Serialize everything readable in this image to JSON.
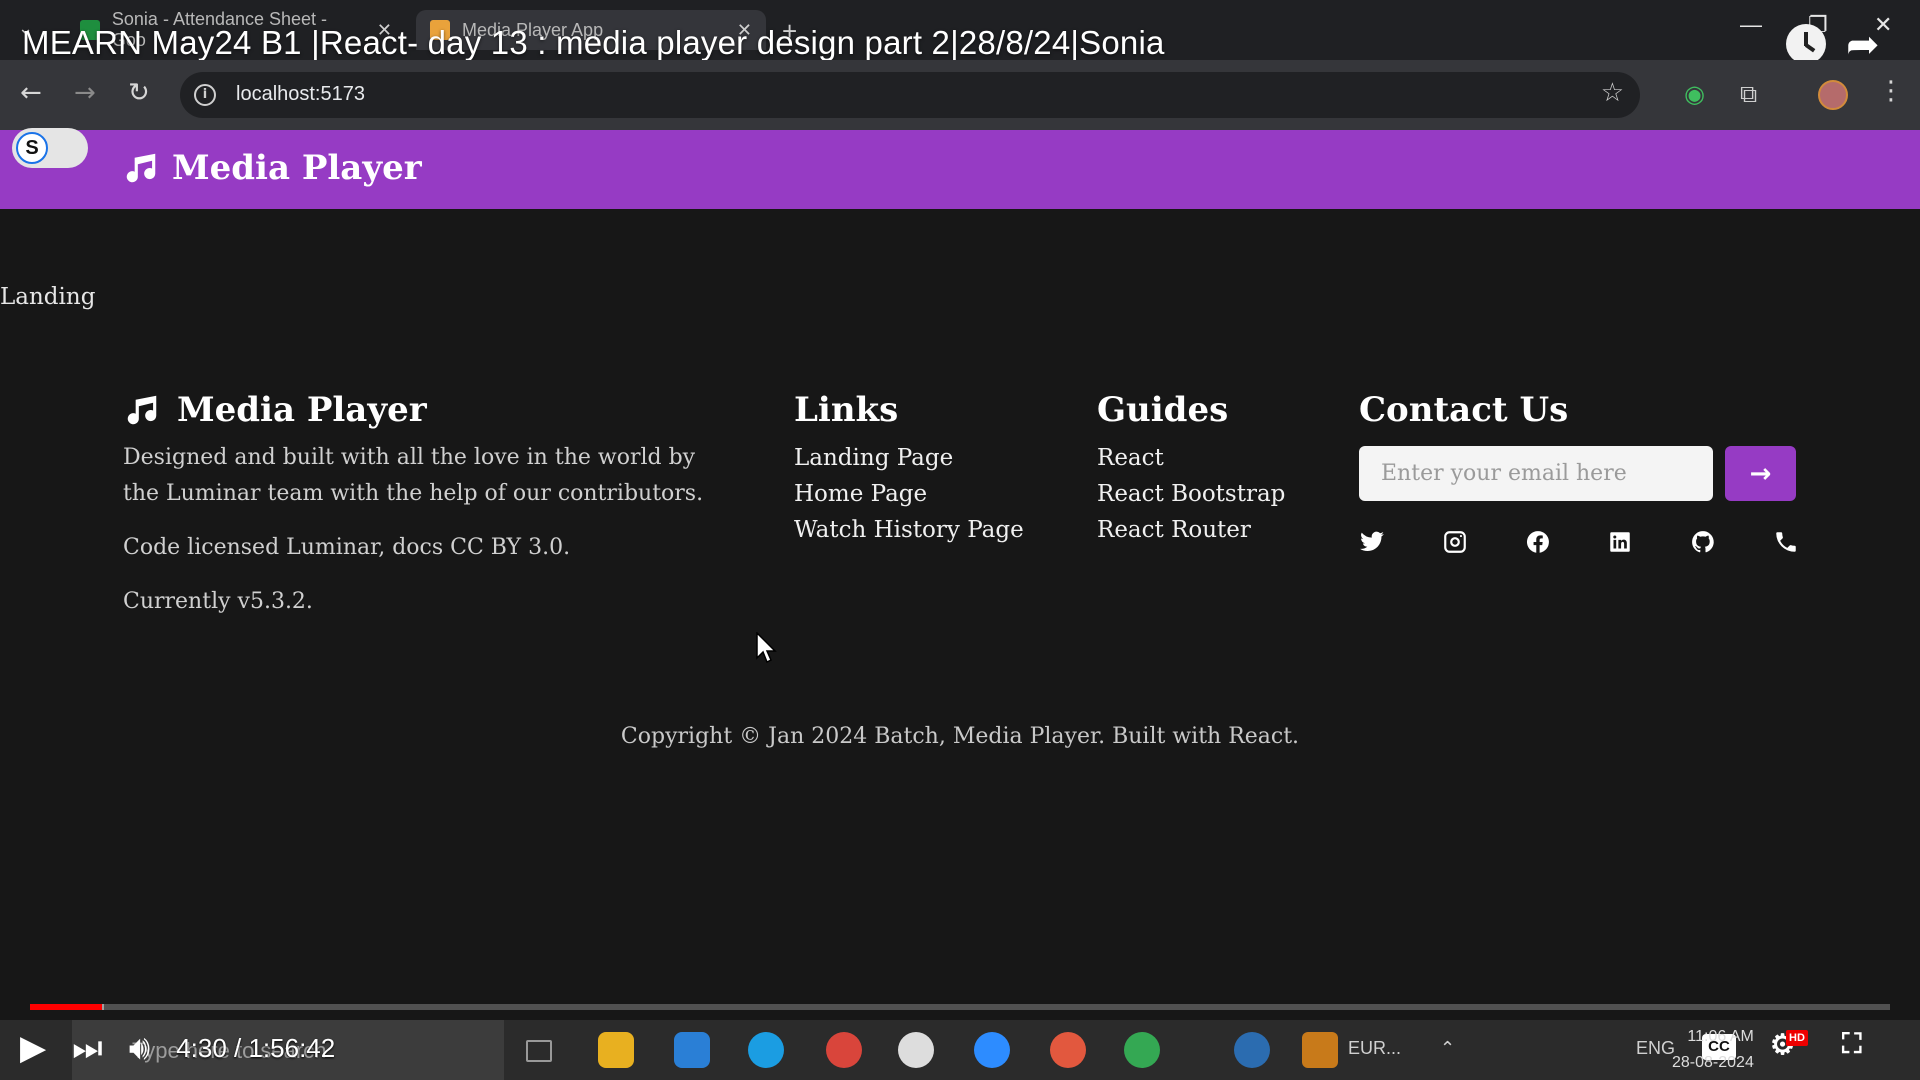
{
  "browser": {
    "tabs": [
      {
        "title": "Sonia - Attendance Sheet - Goo",
        "favicon_color": "#1e8e3e"
      },
      {
        "title": "Media Player App",
        "favicon_color": "#e9a23b"
      }
    ],
    "url": "localhost:5173"
  },
  "overlay": {
    "video_title": "MEARN May24 B1 |React- day 13 : media player design part 2|28/8/24|Sonia",
    "time_display": "4:30 / 1:56:42",
    "progress_fraction": 0.0386,
    "cc_label": "CC",
    "hd_label": "HD"
  },
  "site": {
    "brand": "Media Player",
    "landing_text": "Landing",
    "accent_color": "#963bc4"
  },
  "footer": {
    "about": {
      "title": "Media Player",
      "description": "Designed and built with all the love in the world by the Luminar team with the help of our contributors.",
      "license": "Code licensed Luminar, docs CC BY 3.0.",
      "version": "Currently v5.3.2."
    },
    "links": {
      "title": "Links",
      "items": [
        "Landing Page",
        "Home Page",
        "Watch History Page"
      ]
    },
    "guides": {
      "title": "Guides",
      "items": [
        "React",
        "React Bootstrap",
        "React Router"
      ]
    },
    "contact": {
      "title": "Contact Us",
      "email_placeholder": "Enter your email here",
      "socials": [
        "twitter-icon",
        "instagram-icon",
        "facebook-icon",
        "linkedin-icon",
        "github-icon",
        "phone-icon"
      ]
    },
    "copyright": "Copyright © Jan 2024 Batch, Media Player. Built with React."
  },
  "taskbar": {
    "search_placeholder": "Type here to search",
    "tray_text": "EUR...",
    "language": "ENG",
    "time": "11:06 AM",
    "date": "28-08-2024"
  }
}
